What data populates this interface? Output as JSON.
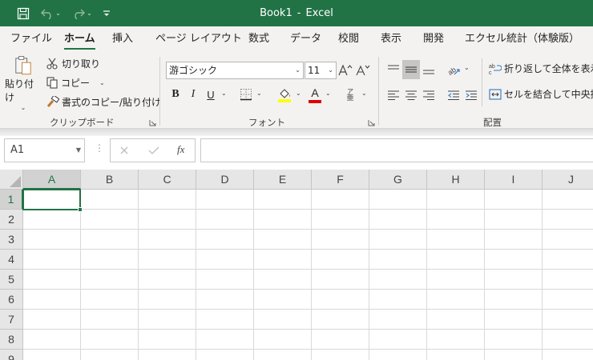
{
  "title_bar": {
    "document": "Book1",
    "separator": "-",
    "app": "Excel"
  },
  "quick_access": [
    "save-icon",
    "undo-icon",
    "redo-icon",
    "customize-icon"
  ],
  "tabs": [
    {
      "label": "ファイル",
      "active": false
    },
    {
      "label": "ホーム",
      "active": true
    },
    {
      "label": "挿入",
      "active": false
    },
    {
      "label": "ページ レイアウト",
      "active": false
    },
    {
      "label": "数式",
      "active": false
    },
    {
      "label": "データ",
      "active": false
    },
    {
      "label": "校閲",
      "active": false
    },
    {
      "label": "表示",
      "active": false
    },
    {
      "label": "開発",
      "active": false
    },
    {
      "label": "エクセル統計（体験版）",
      "active": false
    }
  ],
  "clipboard": {
    "paste_label_1": "貼り付け",
    "cut_label": "切り取り",
    "copy_label": "コピー",
    "format_painter_label": "書式のコピー/貼り付け",
    "group_label": "クリップボード"
  },
  "font": {
    "font_name": "游ゴシック",
    "font_size": "11",
    "bold": "B",
    "italic": "I",
    "underline": "U",
    "font_color_glyph": "A",
    "phonetic_top": "ア",
    "phonetic_bottom": "亜",
    "group_label": "フォント"
  },
  "alignment": {
    "wrap_text_label": "折り返して全体を表示す",
    "merge_label": "セルを結合して中央揃え",
    "group_label": "配置"
  },
  "formula_bar": {
    "name_box": "A1",
    "function_label": "fx",
    "formula": ""
  },
  "colors": {
    "accent": "#217346",
    "fill_color": "#ffff00",
    "font_color": "#e00000"
  },
  "sheet": {
    "columns": [
      "A",
      "B",
      "C",
      "D",
      "E",
      "F",
      "G",
      "H",
      "I",
      "J"
    ],
    "rows": [
      "1",
      "2",
      "3",
      "4",
      "5",
      "6",
      "7",
      "8",
      "9"
    ],
    "selected_cell": "A1"
  }
}
